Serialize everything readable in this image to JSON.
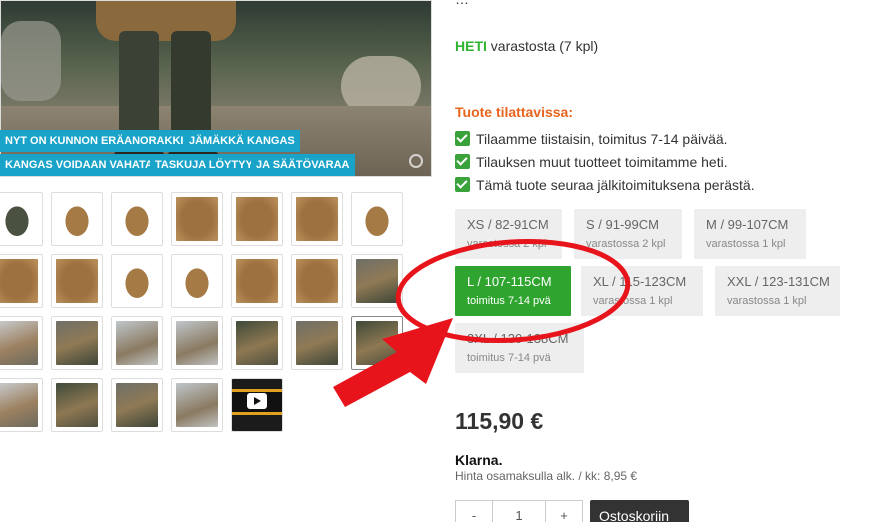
{
  "product": {
    "top_cut_text": "…",
    "stock": {
      "now": "HETI",
      "rest": " varastosta (7 kpl)"
    },
    "order_title": "Tuote tilattavissa:",
    "info": [
      "Tilaamme tiistaisin, toimitus 7-14 päivää.",
      "Tilauksen muut tuotteet toimitamme heti.",
      "Tämä tuote seuraa jälkitoimituksena perästä."
    ],
    "sizes": [
      {
        "label": "XS / 82-91CM",
        "sub": "varastossa 2 kpl"
      },
      {
        "label": "S / 91-99CM",
        "sub": "varastossa 2 kpl"
      },
      {
        "label": "M / 99-107CM",
        "sub": "varastossa 1 kpl"
      },
      {
        "label": "L / 107-115CM",
        "sub": "toimitus 7-14 pvä"
      },
      {
        "label": "XL / 115-123CM",
        "sub": "varastossa 1 kpl"
      },
      {
        "label": "XXL / 123-131CM",
        "sub": "varastossa 1 kpl"
      },
      {
        "label": "3XL / 130-138CM",
        "sub": "toimitus 7-14 pvä"
      }
    ],
    "selected_size": "L / 107-115CM",
    "price": "115,90 €",
    "klarna_logo": "Klarna.",
    "klarna_text": "Hinta osamaksulla alk. / kk: 8,95 €",
    "qty": {
      "minus": "-",
      "value": "1",
      "plus": "+"
    },
    "cart_button": "Ostoskoriin"
  },
  "gallery": {
    "tags": [
      "NYT ON KUNNON ERÄANORAKKI!",
      "JÄMÄKKÄ KANGAS",
      "KANGAS VOIDAAN VAHATA",
      "TASKUJA LÖYTYY",
      "JA SÄÄTÖVARAA"
    ],
    "thumbnails": [
      "jacket-dark",
      "jacket",
      "jacket",
      "jacket-detail",
      "jacket-detail",
      "jacket-detail",
      "jacket",
      "jacket-detail",
      "jacket-detail",
      "jacket",
      "jacket",
      "jacket-detail",
      "jacket-detail",
      "photo",
      "photo",
      "photo",
      "photo",
      "photo",
      "photo",
      "photo",
      "photo",
      "photo",
      "photo",
      "photo",
      "photo",
      "video"
    ]
  },
  "colors": {
    "accent_green": "#2fa52f",
    "tag_blue": "#1aa3c9",
    "annotation_red": "#e8141b",
    "order_orange": "#e8641d"
  },
  "icons": [
    "check-icon",
    "play-icon",
    "zoom-icon"
  ]
}
